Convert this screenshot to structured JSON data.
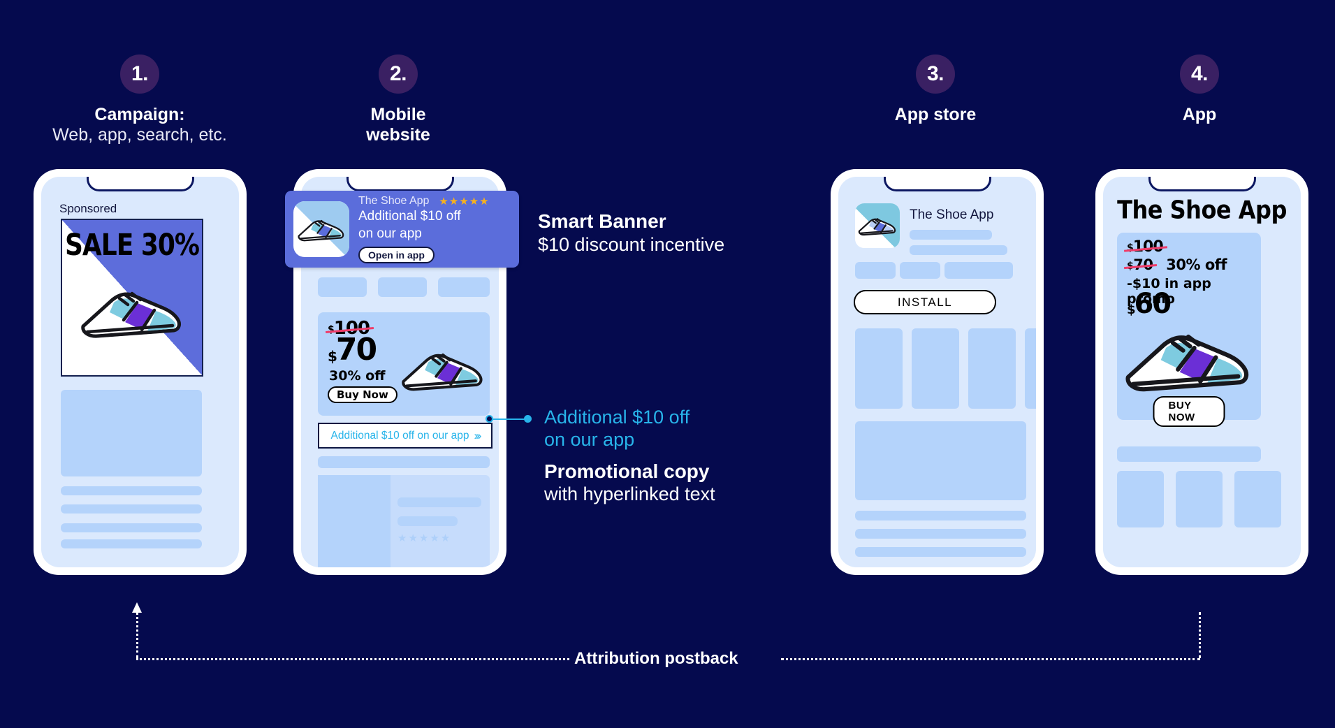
{
  "steps": [
    {
      "number": "1.",
      "title": "Campaign:",
      "subtitle": "Web, app, search, etc."
    },
    {
      "number": "2.",
      "title": "Mobile",
      "subtitle": "website"
    },
    {
      "number": "3.",
      "title": "App store",
      "subtitle": ""
    },
    {
      "number": "4.",
      "title": "App",
      "subtitle": ""
    }
  ],
  "phone1": {
    "sponsored_label": "Sponsored",
    "ad_headline": "SALE 30%"
  },
  "phone2": {
    "smart_banner": {
      "app_name": "The Shoe App",
      "stars": "★★★★★",
      "headline_line1": "Additional $10 off",
      "headline_line2": "on our app",
      "button_label": "Open in app"
    },
    "price_card": {
      "original_price": "100",
      "currency": "$",
      "sale_price": "70",
      "discount": "30% off",
      "buy_label": "Buy Now"
    },
    "promo_link": {
      "text": "Additional $10 off on our app",
      "chevrons": "›››"
    },
    "placeholder_stars": "★★★★★"
  },
  "phone3": {
    "app_name": "The Shoe App",
    "install_label": "INSTALL"
  },
  "phone4": {
    "app_title": "The Shoe App",
    "price_line1": "100",
    "price_line2": "70",
    "price_line2_note": "30% off",
    "price_line3": "-$10 in app promo",
    "price_final": "60",
    "currency": "$",
    "buy_label": "BUY NOW"
  },
  "annotations": {
    "smart_banner": {
      "title": "Smart Banner",
      "subtitle": "$10 discount incentive"
    },
    "promo_copy": {
      "link_line1": "Additional $10 off",
      "link_line2": "on our app",
      "title": "Promotional copy",
      "subtitle": "with hyperlinked text"
    }
  },
  "footer": {
    "attribution_label": "Attribution postback"
  },
  "colors": {
    "background": "#050a4e",
    "step_circle": "#3a2063",
    "banner_purple": "#5b6ddb",
    "link_cyan": "#28b4ea",
    "screen_blue": "#dbe9fd",
    "skeleton_blue": "#b4d3fb",
    "strike_pink": "#ef3b68",
    "star_gold": "#f6b11e"
  }
}
